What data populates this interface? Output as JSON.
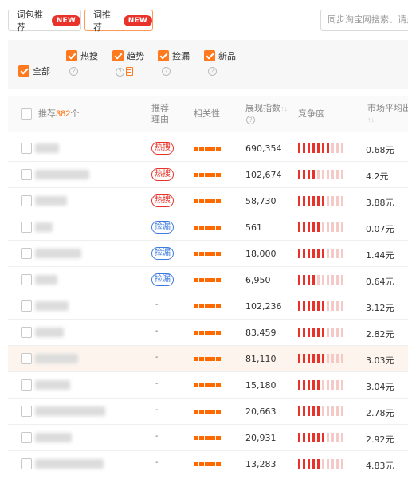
{
  "tabs": [
    {
      "label": "词包推荐",
      "badge": "NEW",
      "active": false
    },
    {
      "label": "词推荐",
      "badge": "NEW",
      "active": true
    }
  ],
  "search": {
    "placeholder": "同步淘宝网搜索、请点"
  },
  "filters": {
    "all": {
      "label": "全部",
      "checked": true
    },
    "options": [
      {
        "label": "热搜",
        "checked": true
      },
      {
        "label": "趋势",
        "checked": true
      },
      {
        "label": "捡漏",
        "checked": true
      },
      {
        "label": "新品",
        "checked": true
      }
    ],
    "help_glyph": "?"
  },
  "table": {
    "headers": {
      "recommend_prefix": "推荐",
      "recommend_count": "382",
      "recommend_suffix": "个",
      "reason": "推荐理由",
      "relevance": "相关性",
      "impression": "展现指数",
      "competition": "竞争度",
      "price": "市场平均出价"
    },
    "sort_glyph": "↑↓",
    "rows": [
      {
        "reason": "热搜",
        "reason_type": "hot",
        "relevance": 5,
        "impression": "690,354",
        "competition": 7,
        "price": "0.68元",
        "kw_blur_width": 30,
        "highlight": false
      },
      {
        "reason": "热搜",
        "reason_type": "hot",
        "relevance": 5,
        "impression": "102,674",
        "competition": 4,
        "price": "4.2元",
        "kw_blur_width": 68,
        "highlight": false
      },
      {
        "reason": "热搜",
        "reason_type": "hot",
        "relevance": 5,
        "impression": "58,730",
        "competition": 6,
        "price": "3.88元",
        "kw_blur_width": 40,
        "highlight": false
      },
      {
        "reason": "捡漏",
        "reason_type": "miss",
        "relevance": 5,
        "impression": "561",
        "competition": 5,
        "price": "0.07元",
        "kw_blur_width": 22,
        "highlight": false
      },
      {
        "reason": "捡漏",
        "reason_type": "miss",
        "relevance": 5,
        "impression": "18,000",
        "competition": 6,
        "price": "1.44元",
        "kw_blur_width": 58,
        "highlight": false
      },
      {
        "reason": "捡漏",
        "reason_type": "miss",
        "relevance": 5,
        "impression": "6,950",
        "competition": 4,
        "price": "0.64元",
        "kw_blur_width": 28,
        "highlight": false
      },
      {
        "reason": "-",
        "reason_type": "none",
        "relevance": 5,
        "impression": "102,236",
        "competition": 6,
        "price": "3.12元",
        "kw_blur_width": 42,
        "highlight": false
      },
      {
        "reason": "-",
        "reason_type": "none",
        "relevance": 5,
        "impression": "83,459",
        "competition": 6,
        "price": "2.82元",
        "kw_blur_width": 36,
        "highlight": false
      },
      {
        "reason": "-",
        "reason_type": "none",
        "relevance": 5,
        "impression": "81,110",
        "competition": 6,
        "price": "3.03元",
        "kw_blur_width": 54,
        "highlight": true
      },
      {
        "reason": "-",
        "reason_type": "none",
        "relevance": 5,
        "impression": "15,180",
        "competition": 5,
        "price": "3.04元",
        "kw_blur_width": 44,
        "highlight": false
      },
      {
        "reason": "-",
        "reason_type": "none",
        "relevance": 5,
        "impression": "20,663",
        "competition": 5,
        "price": "2.78元",
        "kw_blur_width": 88,
        "highlight": false
      },
      {
        "reason": "-",
        "reason_type": "none",
        "relevance": 5,
        "impression": "20,931",
        "competition": 6,
        "price": "2.92元",
        "kw_blur_width": 46,
        "highlight": false
      },
      {
        "reason": "-",
        "reason_type": "none",
        "relevance": 5,
        "impression": "13,283",
        "competition": 5,
        "price": "4.83元",
        "kw_blur_width": 86,
        "highlight": false
      }
    ]
  },
  "colors": {
    "accent": "#ff6a00",
    "hot": "#e8322a",
    "miss": "#3d7be0",
    "competition_on": "#e8322a",
    "competition_off": "#f4c9c6"
  }
}
